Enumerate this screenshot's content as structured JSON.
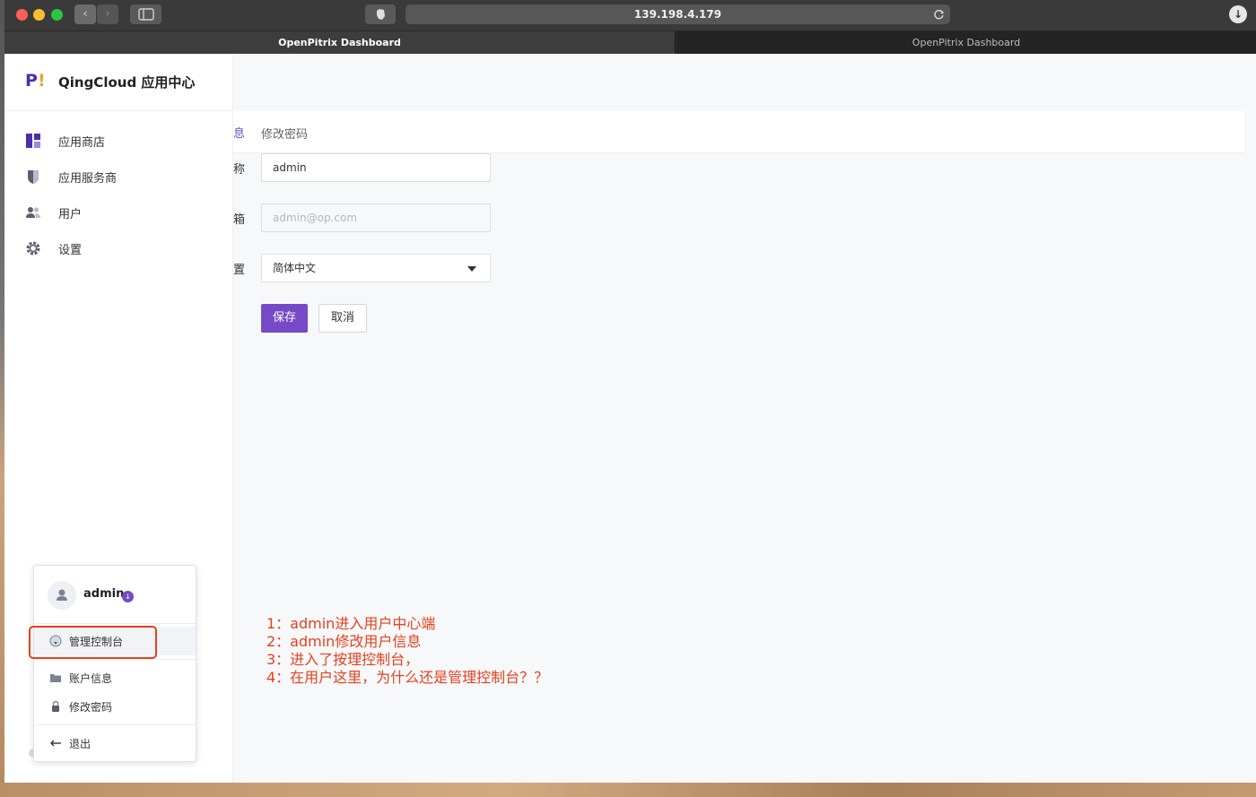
{
  "browser": {
    "back_glyph": "‹",
    "forward_glyph": "›",
    "url": "139.198.4.179",
    "tabs": [
      {
        "title": "OpenPitrix Dashboard",
        "active": true
      },
      {
        "title": "OpenPitrix Dashboard",
        "active": false
      }
    ]
  },
  "sidebar": {
    "logo_mark": "P",
    "logo_bang": "!",
    "app_title": "QingCloud 应用中心",
    "items": [
      {
        "label": "应用商店",
        "icon": "grid-icon"
      },
      {
        "label": "应用服务商",
        "icon": "shield-icon"
      },
      {
        "label": "用户",
        "icon": "users-icon"
      },
      {
        "label": "设置",
        "icon": "gear-icon"
      }
    ]
  },
  "main": {
    "tab_cut": "息",
    "tab_password": "修改密码",
    "form": {
      "username_label_cut": "称",
      "username_value": "admin",
      "email_label_cut": "箱",
      "email_placeholder": "admin@op.com",
      "language_label_cut": "置",
      "language_value": "简体中文",
      "save_label": "保存",
      "cancel_label": "取消"
    }
  },
  "user_menu": {
    "username": "admin",
    "items": [
      {
        "label": "管理控制台",
        "icon": "console-icon",
        "highlighted": true
      },
      {
        "label": "账户信息",
        "icon": "folder-icon"
      },
      {
        "label": "修改密码",
        "icon": "lock-icon"
      },
      {
        "label": "退出",
        "icon": "arrow-left-icon"
      }
    ]
  },
  "annotation": {
    "lines": [
      "1：admin进入用户中心端",
      "2：admin修改用户信息",
      "3：进入了按理控制台，",
      "4：在用户这里，为什么还是管理控制台？？"
    ]
  },
  "colors": {
    "accent": "#7649c6",
    "annotation_red": "#e8401e",
    "logo_purple": "#4b2fa8"
  }
}
